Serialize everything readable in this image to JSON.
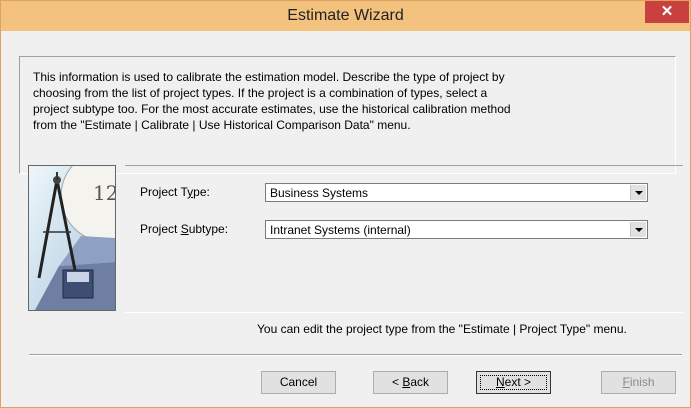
{
  "window": {
    "title": "Estimate Wizard"
  },
  "description": "This information is used to calibrate the estimation model. Describe the type of project by\nchoosing from the list of project types. If the project is a combination of types, select a\nproject subtype too. For the most accurate estimates, use the historical calibration method\nfrom the \"Estimate | Calibrate | Use Historical Comparison Data\" menu.",
  "form": {
    "project_type": {
      "label_pre": "Project T",
      "label_u": "y",
      "label_post": "pe:",
      "value": "Business Systems"
    },
    "project_subtype": {
      "label_pre": "Project ",
      "label_u": "S",
      "label_post": "ubtype:",
      "value": "Intranet Systems (internal)"
    }
  },
  "hint": "You can edit the project type from the \"Estimate | Project Type\" menu.",
  "buttons": {
    "cancel": "Cancel",
    "back": {
      "pre": "< ",
      "u": "B",
      "post": "ack"
    },
    "next": {
      "pre": "",
      "u": "N",
      "post": "ext >"
    },
    "finish": {
      "pre": "",
      "u": "F",
      "post": "inish"
    }
  },
  "colors": {
    "titlebar": "#f3c27e",
    "close": "#c8413f"
  }
}
